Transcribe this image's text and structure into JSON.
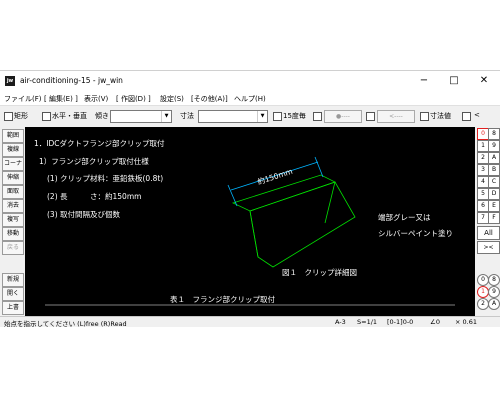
{
  "window": {
    "app_icon": "jw",
    "title": "air-conditioning-15 - jw_win",
    "minimize": "−",
    "maximize": "□",
    "close": "✕"
  },
  "menu": [
    "ファイル(F)",
    "[ 編集(E) ]",
    "表示(V)",
    "[ 作図(D) ]",
    "設定(S)",
    "[その他(A)]",
    "ヘルプ(H)"
  ],
  "toolbar": {
    "rect_label": "矩形",
    "horizontal_vertical_label": "水平・垂直",
    "tilt_label": "傾き",
    "tilt_value": "",
    "dimension_label": "寸法",
    "dimension_value": "",
    "deg15_label": "15度毎",
    "dot_button": "●‑‑‑‑",
    "arrow_button": "<‑‑‑‑",
    "dimension_value_label": "寸法値",
    "lt_label": "<"
  },
  "left_tools": [
    {
      "label": "範囲",
      "enabled": true
    },
    {
      "label": "複線",
      "enabled": true
    },
    {
      "label": "コーナー",
      "enabled": true
    },
    {
      "label": "伸縮",
      "enabled": true
    },
    {
      "label": "面取",
      "enabled": true
    },
    {
      "label": "消去",
      "enabled": true
    },
    {
      "label": "複写",
      "enabled": true
    },
    {
      "label": "移動",
      "enabled": true
    },
    {
      "label": "戻る",
      "enabled": false
    },
    {
      "label": "新規",
      "enabled": true
    },
    {
      "label": "開く",
      "enabled": true
    },
    {
      "label": "上書",
      "enabled": true
    }
  ],
  "right_tools": {
    "layers": [
      "0",
      "8",
      "1",
      "9",
      "2",
      "A",
      "3",
      "B",
      "4",
      "C",
      "5",
      "D",
      "6",
      "E",
      "7",
      "F"
    ],
    "all": "All",
    "expand": "><",
    "group_layers": [
      "0",
      "8",
      "1",
      "9",
      "2",
      "A"
    ]
  },
  "drawing": {
    "line1": "1．IDCダクトフランジ部クリップ取付",
    "line2": "1）フランジ部クリップ取付仕様",
    "line3": "(1) クリップ材料：亜鉛鉄板(0.8t)",
    "line4": "(2) 長　　　さ：約150mm",
    "line5": "(3) 取付間隔及び個数",
    "dim_label": "約150mm",
    "note1": "端部グレー又は",
    "note2": "シルバーペイント塗り",
    "figure_caption": "図１　クリップ詳細図",
    "table_caption": "表１　フランジ部クリップ取付",
    "colors": {
      "background": "#000000",
      "text": "#ffffff",
      "clip": "#00e000",
      "dimension": "#00b4ff"
    }
  },
  "status": {
    "prompt": "始点を指示してください (L)free (R)Read",
    "paper": "A-3",
    "scale": "S=1/1",
    "layer": "[0-1]0-0",
    "angle": "∠0",
    "zoom": "× 0.61"
  }
}
